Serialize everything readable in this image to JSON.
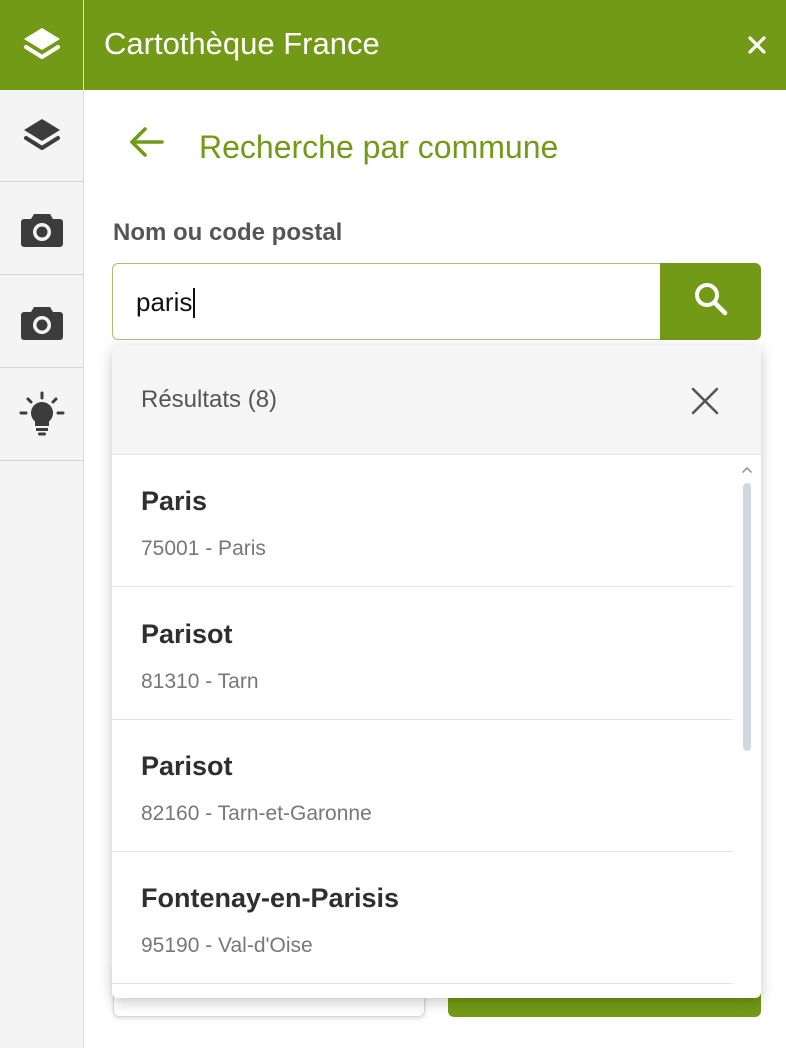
{
  "header": {
    "title": "Cartothèque France",
    "close_icon": "close-icon"
  },
  "rail": {
    "items": [
      {
        "icon": "layers-icon",
        "active": true
      },
      {
        "icon": "layers-icon",
        "active": false
      },
      {
        "icon": "camera-icon",
        "active": false
      },
      {
        "icon": "camera-icon",
        "active": false
      },
      {
        "icon": "lightbulb-icon",
        "active": false
      }
    ]
  },
  "panel": {
    "back_icon": "arrow-left-icon",
    "title": "Recherche par commune",
    "field_label": "Nom ou code postal",
    "search": {
      "value": "paris",
      "button_icon": "search-icon"
    }
  },
  "results": {
    "header": "Résultats (8)",
    "close_icon": "close-icon",
    "items": [
      {
        "name": "Paris",
        "detail": "75001 - Paris"
      },
      {
        "name": "Parisot",
        "detail": "81310 - Tarn"
      },
      {
        "name": "Parisot",
        "detail": "82160 - Tarn-et-Garonne"
      },
      {
        "name": "Fontenay-en-Parisis",
        "detail": "95190 - Val-d'Oise"
      }
    ]
  },
  "colors": {
    "brand_green": "#729a16",
    "rail_bg": "#f4f4f4",
    "text_dark": "#2f2f2f",
    "text_muted": "#777777"
  }
}
